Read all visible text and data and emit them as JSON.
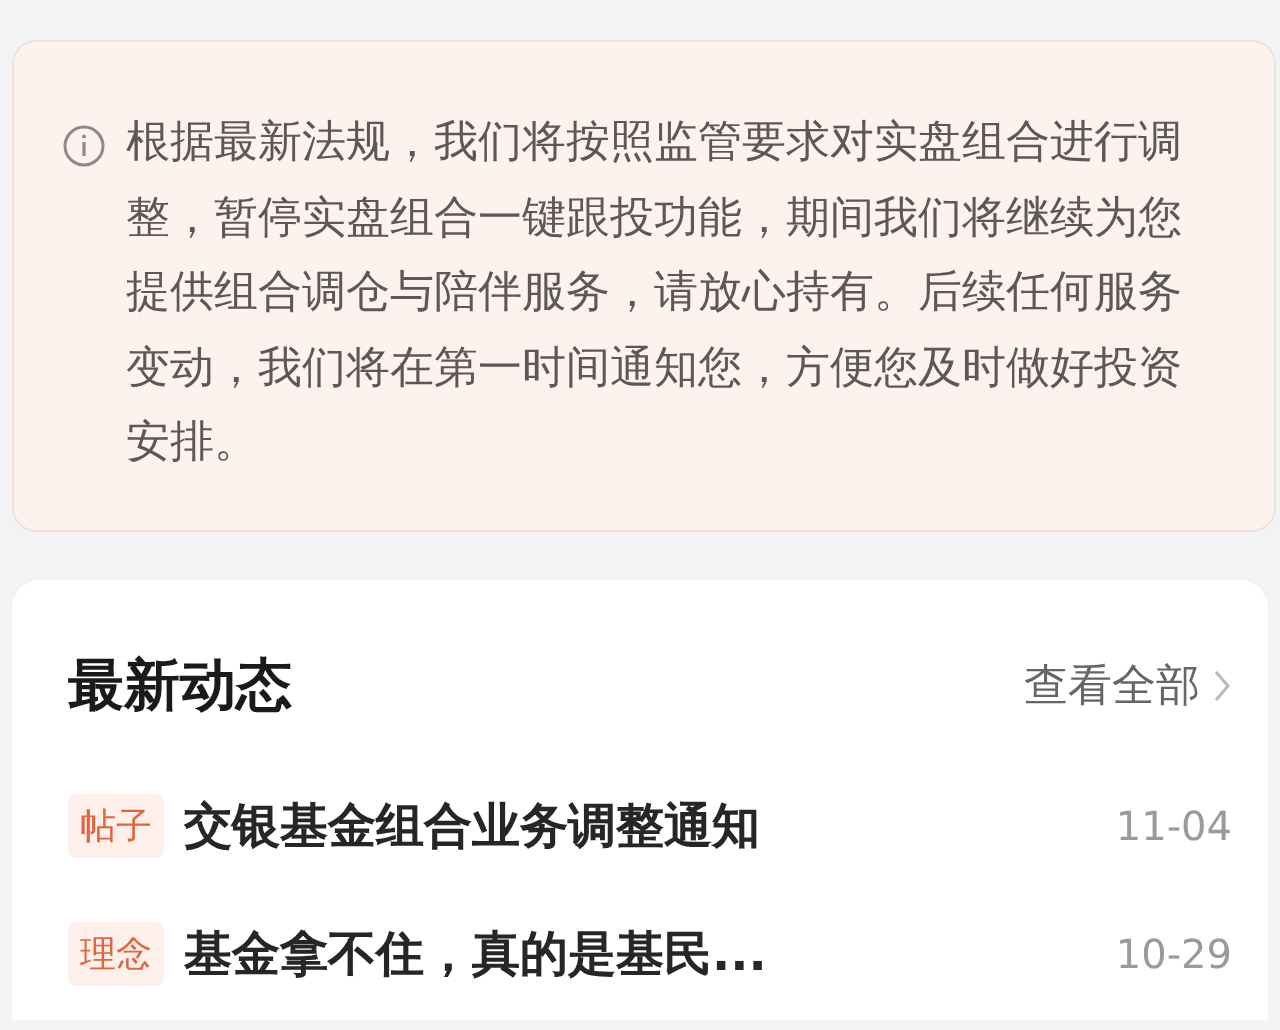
{
  "notice": {
    "text": "根据最新法规，我们将按照监管要求对实盘组合进行调整，暂停实盘组合一键跟投功能，期间我们将继续为您提供组合调仓与陪伴服务，请放心持有。后续任何服务变动，我们将在第一时间通知您，方便您及时做好投资安排。"
  },
  "news": {
    "title": "最新动态",
    "view_all": "查看全部",
    "items": [
      {
        "tag": "帖子",
        "title": "交银基金组合业务调整通知",
        "date": "11-04"
      },
      {
        "tag": "理念",
        "title": "基金拿不住，真的是基民...",
        "date": "10-29"
      }
    ]
  }
}
